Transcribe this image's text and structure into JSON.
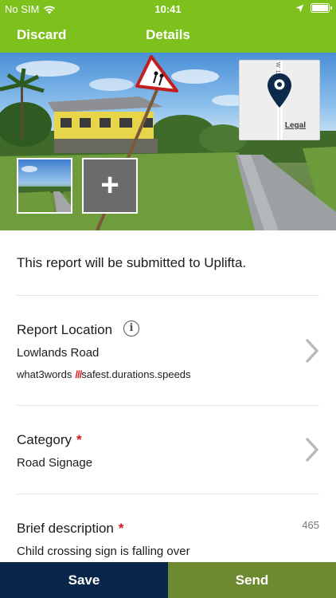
{
  "status_bar": {
    "carrier": "No SIM",
    "time": "10:41",
    "icons": [
      "wifi-icon",
      "location-arrow-icon",
      "battery-icon"
    ]
  },
  "nav": {
    "discard_label": "Discard",
    "title": "Details"
  },
  "photo_area": {
    "add_photo_glyph": "+",
    "map_legal": "Legal",
    "map_street_label": "W L"
  },
  "report": {
    "submit_note": "This report will be submitted to Uplifta.",
    "location": {
      "title": "Report Location",
      "road": "Lowlands Road",
      "w3w_label": "what3words",
      "w3w_slashes": "///",
      "w3w_address": "safest.durations.speeds"
    },
    "category": {
      "title": "Category",
      "required_mark": "*",
      "value": "Road Signage"
    },
    "description": {
      "title": "Brief description",
      "required_mark": "*",
      "char_count": "465",
      "value": "Child crossing sign is falling over"
    }
  },
  "actions": {
    "save_label": "Save",
    "send_label": "Send"
  },
  "colors": {
    "header_green": "#7ec11c",
    "save_navy": "#08264a",
    "send_olive": "#6d8a30",
    "required_red": "#d0191d",
    "w3w_red": "#e11f26"
  }
}
